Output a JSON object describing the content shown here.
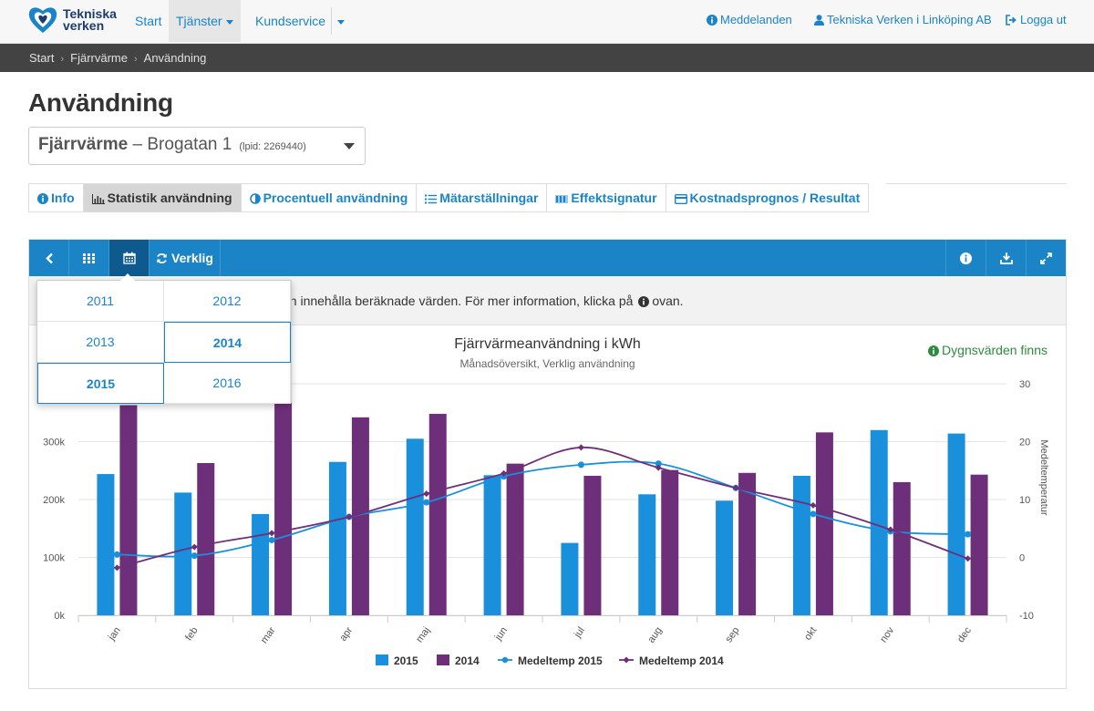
{
  "brand": {
    "name_line1": "Tekniska",
    "name_line2": "verken"
  },
  "nav": {
    "start": "Start",
    "tjanster": "Tjänster",
    "kundservice": "Kundservice",
    "meddelanden": "Meddelanden",
    "company": "Tekniska Verken i Linköping AB",
    "logout": "Logga ut"
  },
  "breadcrumb": [
    "Start",
    "Fjärrvärme",
    "Användning"
  ],
  "page_title": "Användning",
  "facility": {
    "type": "Fjärrvärme",
    "dash": "–",
    "address": "Brogatan 1",
    "id": "(lpid: 2269440)"
  },
  "tabs": [
    "Info",
    "Statistik användning",
    "Procentuell användning",
    "Mätarställningar",
    "Effektsignatur",
    "Kostnadsprognos / Resultat"
  ],
  "toolbar": {
    "verklig": "Verklig"
  },
  "info_text": "an innehålla beräknade värden. För mer information, klicka på",
  "info_text_tail": "ovan.",
  "dygn": "Dygnsvärden finns",
  "year_picker": {
    "years": [
      "2011",
      "2012",
      "2013",
      "2014",
      "2015",
      "2016"
    ],
    "selected": [
      "2014",
      "2015"
    ]
  },
  "colors": {
    "s2015": "#1a8fdc",
    "s2014": "#6e2f7a",
    "accent": "#1a84c7",
    "toolbar_active": "#0e5a8e"
  },
  "chart_data": {
    "type": "bar",
    "title": "Fjärrvärmeanvändning i kWh",
    "subtitle": "Månadsöversikt, Verklig användning",
    "categories": [
      "jan",
      "feb",
      "mar",
      "apr",
      "maj",
      "jun",
      "jul",
      "aug",
      "sep",
      "okt",
      "nov",
      "dec"
    ],
    "ylim": [
      0,
      400000
    ],
    "yticks": [
      "0k",
      "100k",
      "200k",
      "300k"
    ],
    "y2label": "Medeltemperatur",
    "y2lim": [
      -10,
      30
    ],
    "y2ticks": [
      "-10",
      "0",
      "10",
      "20",
      "30"
    ],
    "grid": true,
    "legend_placement": "bottom",
    "series": [
      {
        "name": "2015",
        "type": "bar",
        "values": [
          244000,
          212000,
          175000,
          265000,
          305000,
          242000,
          125000,
          209000,
          198000,
          241000,
          320000,
          314000
        ]
      },
      {
        "name": "2014",
        "type": "bar",
        "values": [
          363000,
          263000,
          370000,
          342000,
          348000,
          262000,
          241000,
          251000,
          246000,
          316000,
          230000,
          243000
        ]
      },
      {
        "name": "Medeltemp 2015",
        "type": "line",
        "axis": "y2",
        "values": [
          0.5,
          0.3,
          3,
          7,
          9.5,
          14,
          16,
          16.2,
          12,
          7.5,
          4.5,
          4
        ]
      },
      {
        "name": "Medeltemp 2014",
        "type": "line",
        "axis": "y2",
        "values": [
          -1.8,
          1.8,
          4.2,
          7,
          11,
          14.5,
          19,
          15.5,
          12,
          9,
          4.8,
          -0.2
        ]
      }
    ]
  }
}
